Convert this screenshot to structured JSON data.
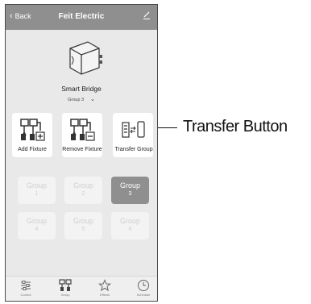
{
  "header": {
    "back_label": "Back",
    "title": "Feit Electric"
  },
  "device": {
    "name": "Smart Bridge",
    "group_selected": "Group 3"
  },
  "actions": [
    {
      "label": "Add Fixture",
      "icon": "add-fixture-icon"
    },
    {
      "label": "Remove Fixture",
      "icon": "remove-fixture-icon"
    },
    {
      "label": "Transfer Group",
      "icon": "transfer-group-icon"
    }
  ],
  "groups": [
    {
      "name": "Group",
      "number": "1",
      "active": false
    },
    {
      "name": "Group",
      "number": "2",
      "active": false
    },
    {
      "name": "Group",
      "number": "3",
      "active": true
    },
    {
      "name": "Group",
      "number": "4",
      "active": false
    },
    {
      "name": "Group",
      "number": "5",
      "active": false
    },
    {
      "name": "Group",
      "number": "6",
      "active": false
    }
  ],
  "tabs": [
    {
      "label": "Control",
      "icon": "sliders-icon"
    },
    {
      "label": "Group",
      "icon": "group-icon"
    },
    {
      "label": "Effects",
      "icon": "star-icon"
    },
    {
      "label": "Schedule",
      "icon": "clock-icon"
    }
  ],
  "callout": {
    "label": "Transfer Button"
  },
  "colors": {
    "header_bg": "#8f8f8f",
    "screen_bg": "#e9e9e9",
    "active_group": "#8f8f8f"
  }
}
